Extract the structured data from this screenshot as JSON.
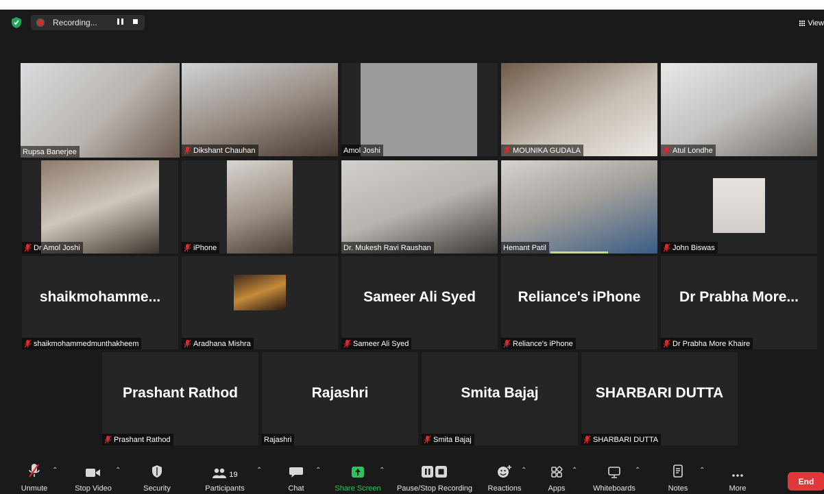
{
  "topbar": {
    "recording_label": "Recording...",
    "view_label": "View"
  },
  "participants": [
    {
      "name": "Rupsa Banerjee",
      "big": "",
      "muted": false,
      "active": true
    },
    {
      "name": "Dikshant Chauhan",
      "big": "",
      "muted": true
    },
    {
      "name": "Amol Joshi",
      "big": "",
      "muted": false
    },
    {
      "name": "MOUNIKA GUDALA",
      "big": "",
      "muted": true
    },
    {
      "name": "Atul Londhe",
      "big": "",
      "muted": true
    },
    {
      "name": "Dr Amol Joshi",
      "big": "",
      "muted": true
    },
    {
      "name": "iPhone",
      "big": "",
      "muted": true
    },
    {
      "name": "Dr. Mukesh Ravi Raushan",
      "big": "",
      "muted": false
    },
    {
      "name": "Hemant Patil",
      "big": "",
      "muted": false
    },
    {
      "name": "John Biswas",
      "big": "",
      "muted": true
    },
    {
      "name": "shaikmohammedmunthakheem",
      "big": "shaikmohamme...",
      "muted": true
    },
    {
      "name": "Aradhana Mishra",
      "big": "",
      "muted": true
    },
    {
      "name": "Sameer Ali Syed",
      "big": "Sameer Ali Syed",
      "muted": true
    },
    {
      "name": "Reliance's iPhone",
      "big": "Reliance's iPhone",
      "muted": true
    },
    {
      "name": "Dr Prabha More Khaire",
      "big": "Dr Prabha More...",
      "muted": true
    },
    {
      "name": "Prashant Rathod",
      "big": "Prashant Rathod",
      "muted": true
    },
    {
      "name": "Rajashri",
      "big": "Rajashri",
      "muted": false
    },
    {
      "name": "Smita Bajaj",
      "big": "Smita Bajaj",
      "muted": true
    },
    {
      "name": "SHARBARI DUTTA",
      "big": "SHARBARI DUTTA",
      "muted": true
    }
  ],
  "toolbar": {
    "unmute": "Unmute",
    "stop_video": "Stop Video",
    "security": "Security",
    "participants": "Participants",
    "participants_count": "19",
    "chat": "Chat",
    "share_screen": "Share Screen",
    "pause_stop_recording": "Pause/Stop Recording",
    "reactions": "Reactions",
    "apps": "Apps",
    "whiteboards": "Whiteboards",
    "notes": "Notes",
    "more": "More",
    "end": "End"
  },
  "colors": {
    "active_speaker_border": "#c3df76",
    "mute_red": "#e02828",
    "share_green": "#2fc25b",
    "end_red": "#e0373b"
  }
}
